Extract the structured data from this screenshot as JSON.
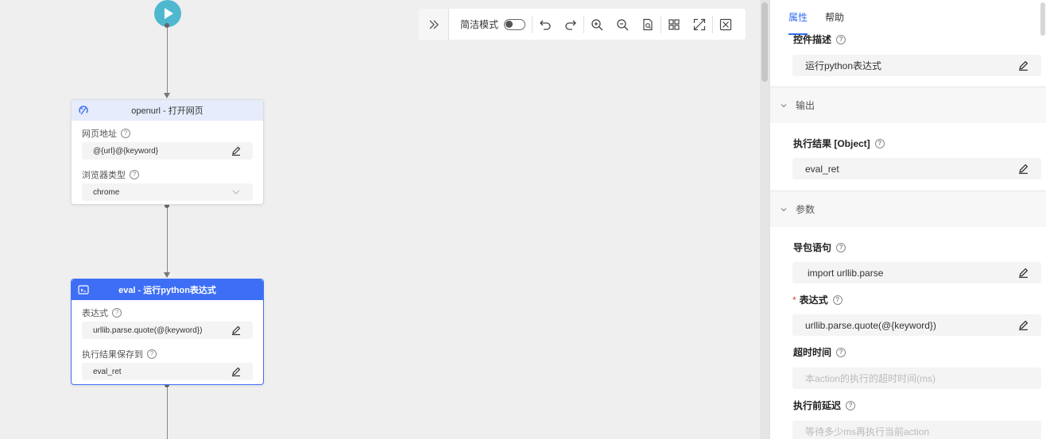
{
  "toolbar": {
    "mode_label": "简洁模式"
  },
  "nodes": {
    "openurl": {
      "title": "openurl - 打开网页",
      "fields": [
        {
          "label": "网页地址",
          "value": "@{url}@{keyword}"
        },
        {
          "label": "浏览器类型",
          "value": "chrome"
        }
      ]
    },
    "eval": {
      "title": "eval - 运行python表达式",
      "fields": [
        {
          "label": "表达式",
          "value": "urllib.parse.quote(@{keyword})"
        },
        {
          "label": "执行结果保存到",
          "value": "eval_ret"
        }
      ]
    }
  },
  "panel": {
    "tabs": [
      {
        "label": "属性",
        "active": true
      },
      {
        "label": "帮助",
        "active": false
      }
    ],
    "description": {
      "label": "控件描述",
      "value": "运行python表达式"
    },
    "sections": {
      "output": "输出",
      "params": "参数"
    },
    "output_field": {
      "label": "执行结果 [Object]",
      "value": "eval_ret"
    },
    "params": {
      "import": {
        "label": "导包语句",
        "value": "import urllib.parse"
      },
      "expression": {
        "label": "表达式",
        "required_mark": "*",
        "value": "urllib.parse.quote(@{keyword})"
      },
      "timeout": {
        "label": "超时时间",
        "placeholder": "本action的执行的超时时间(ms)"
      },
      "delay": {
        "label": "执行前延迟",
        "placeholder": "等待多少ms再执行当前action"
      }
    }
  },
  "colors": {
    "accent": "#3d6ef5",
    "start_button": "#4fb8cf",
    "tab_active": "#2f6bf1",
    "required": "#e0413a"
  }
}
